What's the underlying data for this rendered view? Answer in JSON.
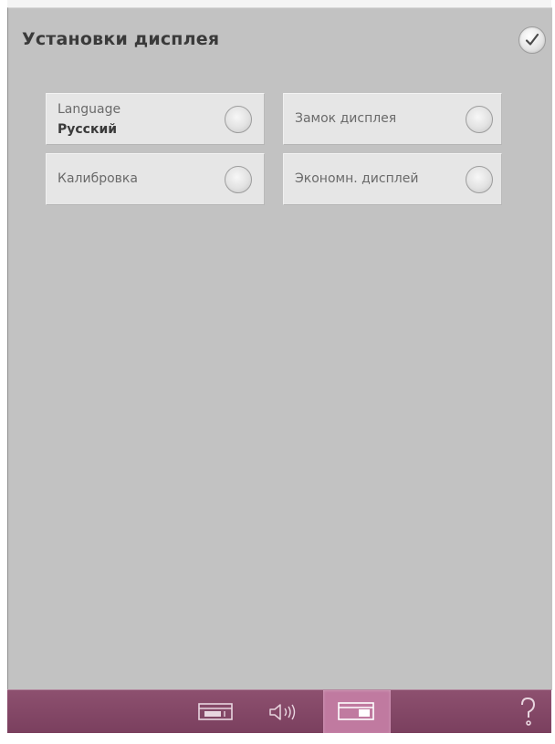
{
  "screen": {
    "title": "Установки дисплея"
  },
  "settings": {
    "language": {
      "label": "Language",
      "value": "Русский",
      "selected": false
    },
    "display_lock": {
      "label": "Замок дисплея",
      "selected": false
    },
    "calibration": {
      "label": "Калибровка",
      "selected": false
    },
    "eco_display": {
      "label": "Экономн. дисплей",
      "selected": false
    }
  },
  "toolbar": {
    "active": "display-settings",
    "icons": [
      "sewing-machine-settings-icon",
      "sound-settings-icon",
      "display-settings-icon",
      "help-icon"
    ]
  },
  "colors": {
    "panel_background": "#c2c2c2",
    "tile_background": "#e6e6e6",
    "toolbar": "#853f66",
    "toolbar_active": "#c07aa0"
  }
}
